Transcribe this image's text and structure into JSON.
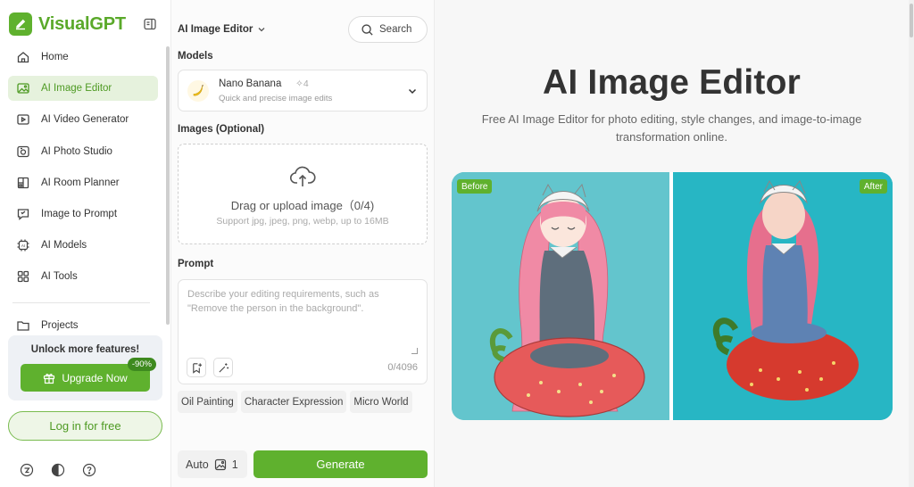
{
  "brand": {
    "name": "VisualGPT",
    "accent": "#5fb12e"
  },
  "sidebar": {
    "items": [
      {
        "label": "Home",
        "icon": "home-icon"
      },
      {
        "label": "AI Image Editor",
        "icon": "image-edit-icon",
        "active": true
      },
      {
        "label": "AI Video Generator",
        "icon": "video-icon"
      },
      {
        "label": "AI Photo Studio",
        "icon": "camera-icon"
      },
      {
        "label": "AI Room Planner",
        "icon": "room-icon"
      },
      {
        "label": "Image to Prompt",
        "icon": "prompt-icon"
      },
      {
        "label": "AI Models",
        "icon": "ai-chip-icon"
      },
      {
        "label": "AI Tools",
        "icon": "grid-icon"
      }
    ],
    "projects": "Projects",
    "promo_title": "Unlock more features!",
    "upgrade_label": "Upgrade Now",
    "discount": "-90%",
    "login_label": "Log in for free"
  },
  "panel": {
    "tool_name": "AI Image Editor",
    "search_label": "Search",
    "models_label": "Models",
    "model": {
      "name": "Nano Banana",
      "credits": "4",
      "description": "Quick and precise image edits"
    },
    "images_label": "Images (Optional)",
    "upload_text": "Drag or upload image（0/4)",
    "upload_sub": "Support jpg, jpeg, png, webp, up to 16MB",
    "prompt_label": "Prompt",
    "prompt_placeholder": "Describe your editing requirements, such as \"Remove the person in the background\".",
    "prompt_count": "0/4096",
    "chips": [
      "Oil Painting",
      "Character Expression",
      "Micro World"
    ],
    "auto_label": "Auto",
    "image_count": "1",
    "generate_label": "Generate"
  },
  "main": {
    "title": "AI Image Editor",
    "subtitle": "Free AI Image Editor for photo editing, style changes, and image-to-image transformation online.",
    "before_label": "Before",
    "after_label": "After"
  }
}
